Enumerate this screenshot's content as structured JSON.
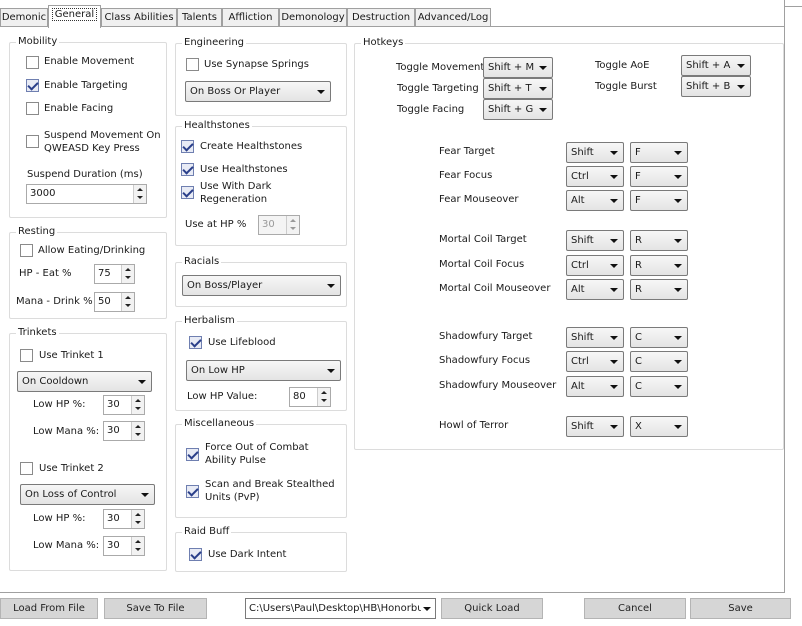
{
  "tabs": [
    "Demonic",
    "General",
    "Class Abilities",
    "Talents",
    "Affliction",
    "Demonology",
    "Destruction",
    "Advanced/Log"
  ],
  "mobility": {
    "title": "Mobility",
    "enable_movement": "Enable Movement",
    "enable_targeting": "Enable Targeting",
    "enable_facing": "Enable Facing",
    "suspend_movement": "Suspend Movement On QWEASD Key Press",
    "suspend_duration_label": "Suspend Duration (ms)",
    "suspend_duration_value": "3000"
  },
  "resting": {
    "title": "Resting",
    "allow_eating": "Allow Eating/Drinking",
    "hp_eat_label": "HP - Eat %",
    "hp_eat_value": "75",
    "mana_drink_label": "Mana - Drink %",
    "mana_drink_value": "50"
  },
  "trinkets": {
    "title": "Trinkets",
    "use_trinket1": "Use Trinket 1",
    "trinket1_mode": "On Cooldown",
    "low_hp_label": "Low HP %:",
    "low_mana_label": "Low Mana %:",
    "t1_low_hp": "30",
    "t1_low_mana": "30",
    "use_trinket2": "Use Trinket 2",
    "trinket2_mode": "On Loss of Control",
    "t2_low_hp": "30",
    "t2_low_mana": "30"
  },
  "engineering": {
    "title": "Engineering",
    "use_synapse": "Use Synapse Springs",
    "mode": "On Boss Or Player"
  },
  "healthstones": {
    "title": "Healthstones",
    "create": "Create Healthstones",
    "use": "Use Healthstones",
    "use_with_dark": "Use With Dark Regeneration",
    "use_at_hp_label": "Use at HP %",
    "use_at_hp_value": "30"
  },
  "racials": {
    "title": "Racials",
    "mode": "On Boss/Player"
  },
  "herbalism": {
    "title": "Herbalism",
    "use_lifeblood": "Use Lifeblood",
    "mode": "On Low HP",
    "low_hp_label": "Low HP Value:",
    "low_hp_value": "80"
  },
  "misc": {
    "title": "Miscellaneous",
    "force_ooc": "Force Out of Combat Ability Pulse",
    "scan_stealthed": "Scan and Break Stealthed Units (PvP)"
  },
  "raidbuff": {
    "title": "Raid Buff",
    "use_dark_intent": "Use Dark Intent"
  },
  "hotkeys": {
    "title": "Hotkeys",
    "toggles": [
      {
        "label": "Toggle Movement",
        "key": "Shift + M"
      },
      {
        "label": "Toggle Targeting",
        "key": "Shift + T"
      },
      {
        "label": "Toggle Facing",
        "key": "Shift + G"
      },
      {
        "label": "Toggle AoE",
        "key": "Shift + A"
      },
      {
        "label": "Toggle Burst",
        "key": "Shift + B"
      }
    ],
    "bindings": [
      {
        "label": "Fear Target",
        "mod": "Shift",
        "key": "F"
      },
      {
        "label": "Fear Focus",
        "mod": "Ctrl",
        "key": "F"
      },
      {
        "label": "Fear Mouseover",
        "mod": "Alt",
        "key": "F"
      },
      {
        "label": "Mortal Coil Target",
        "mod": "Shift",
        "key": "R"
      },
      {
        "label": "Mortal Coil Focus",
        "mod": "Ctrl",
        "key": "R"
      },
      {
        "label": "Mortal Coil Mouseover",
        "mod": "Alt",
        "key": "R"
      },
      {
        "label": "Shadowfury Target",
        "mod": "Shift",
        "key": "C"
      },
      {
        "label": "Shadowfury Focus",
        "mod": "Ctrl",
        "key": "C"
      },
      {
        "label": "Shadowfury Mouseover",
        "mod": "Alt",
        "key": "C"
      },
      {
        "label": "Howl of Terror",
        "mod": "Shift",
        "key": "X"
      }
    ]
  },
  "footer": {
    "load_from_file": "Load From File",
    "save_to_file": "Save To File",
    "path": "C:\\Users\\Paul\\Desktop\\HB\\Honorbu",
    "quick_load": "Quick Load",
    "cancel": "Cancel",
    "save": "Save"
  }
}
